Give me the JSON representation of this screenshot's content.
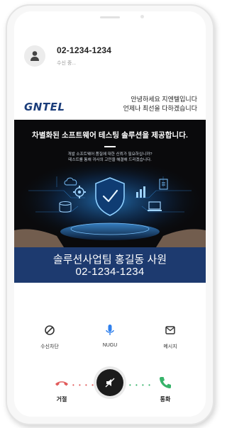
{
  "caller": {
    "number": "02-1234-1234",
    "status": "수신 중..."
  },
  "brand": {
    "logo_text": "GNTEL",
    "logo_color": "#1b3d7a",
    "greeting_line1": "안녕하세요 지엔텔입니다",
    "greeting_line2": "언제나 최선을 다하겠습니다"
  },
  "banner": {
    "headline": "차별화된 소프트웨어 테스팅 솔루션을 제공합니다.",
    "sub_line1": "개발 소프트웨어 품질에 대한 신뢰가 필요하십니까?",
    "sub_line2": "테스트를 통해 귀사의 고민을 해결해 드리겠습니다.",
    "art_icons": [
      "shield-check-icon",
      "gear-icon",
      "chart-icon",
      "cloud-icon",
      "laptop-icon",
      "database-icon",
      "clipboard-icon"
    ]
  },
  "contact_card": {
    "name_line": "솔루션사업팀 홍길동 사원",
    "number_line": "02-1234-1234",
    "background": "#1d3a6f"
  },
  "actions": [
    {
      "label": "수신차단",
      "icon": "block-icon"
    },
    {
      "label": "NUGU",
      "icon": "microphone-icon"
    },
    {
      "label": "메시지",
      "icon": "message-icon"
    }
  ],
  "controls": {
    "decline_label": "거절",
    "answer_label": "통화",
    "decline_color": "#e15a5a",
    "answer_color": "#37b36a",
    "center_icon": "mute-icon",
    "dots": "• • • •"
  }
}
